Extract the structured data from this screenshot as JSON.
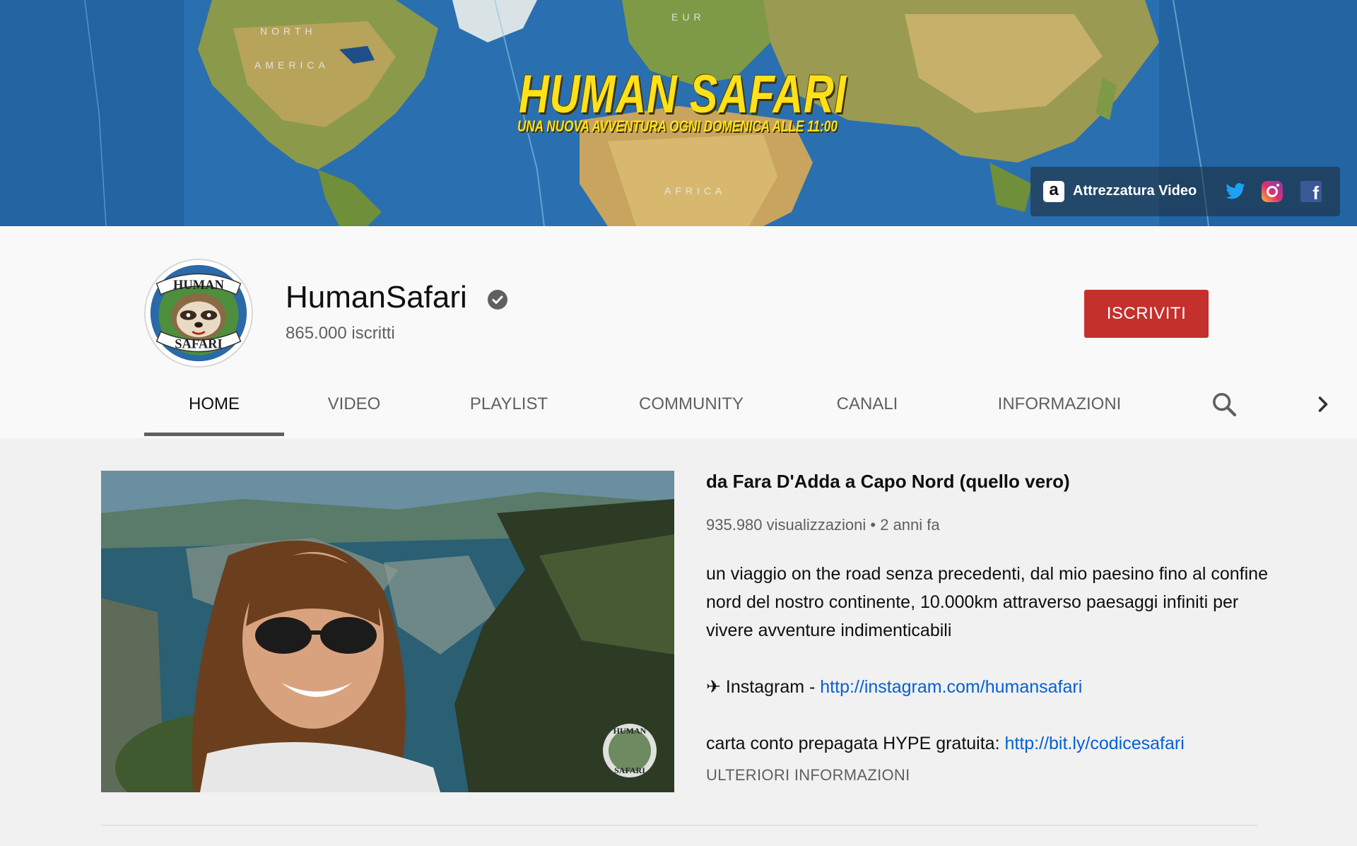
{
  "banner": {
    "title": "HUMAN SAFARI",
    "subtitle": "UNA NUOVA AVVENTURA OGNI DOMENICA ALLE 11:00",
    "map_labels": [
      "NORTH",
      "AMERICA",
      "EUR",
      "AFRICA"
    ],
    "links": {
      "amazon_label": "Attrezzatura Video",
      "amazon_glyph": "a",
      "facebook_glyph": "f"
    }
  },
  "channel": {
    "name": "HumanSafari",
    "subscribers": "865.000 iscritti",
    "avatar_text_top": "HUMAN",
    "avatar_text_bottom": "SAFARI",
    "subscribe_label": "ISCRIVITI",
    "subscribe_color": "#c4302b"
  },
  "tabs": [
    {
      "label": "HOME",
      "active": true
    },
    {
      "label": "VIDEO",
      "active": false
    },
    {
      "label": "PLAYLIST",
      "active": false
    },
    {
      "label": "COMMUNITY",
      "active": false
    },
    {
      "label": "CANALI",
      "active": false
    },
    {
      "label": "INFORMAZIONI",
      "active": false
    }
  ],
  "icons": {
    "tabs_search": "search-icon",
    "tabs_next": "chevron-right-icon",
    "verified": "verified-check-icon"
  },
  "featured": {
    "title": "da Fara D'Adda a Capo Nord (quello vero)",
    "views": "935.980 visualizzazioni",
    "separator": "•",
    "age": "2 anni fa",
    "description_line1": "un viaggio on the road senza precedenti, dal mio paesino fino al confine nord del nostro continente, 10.000km attraverso paesaggi infiniti per vivere avventure indimenticabili",
    "instagram_prefix": "✈ Instagram - ",
    "instagram_url": "http://instagram.com/humansafari",
    "hype_prefix": "carta conto prepagata HYPE gratuita: ",
    "hype_url": "http://bit.ly/codicesafari",
    "more_label": "ULTERIORI INFORMAZIONI",
    "watermark_top": "HUMAN",
    "watermark_bottom": "SAFARI"
  },
  "colors": {
    "link": "#065fd4",
    "banner_title": "#ffe11a"
  }
}
